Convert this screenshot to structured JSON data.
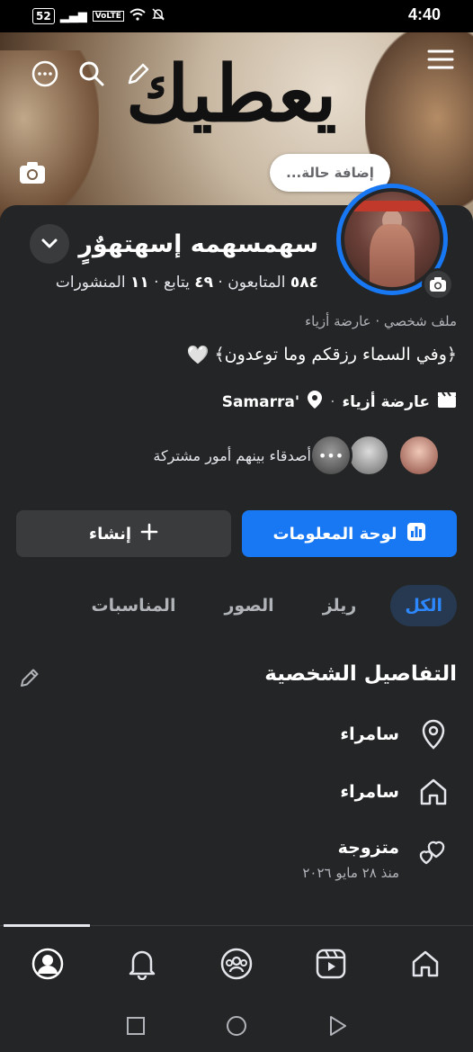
{
  "status_bar": {
    "battery": "52",
    "network": "VoLTE",
    "time": "4:40"
  },
  "cover": {
    "status_placeholder": "إضافة حالة...",
    "calligraphy": "يعطيك"
  },
  "profile": {
    "name": "سهمسهمه إسهتهوٌرٍ",
    "stats": {
      "posts_count": "١١",
      "posts_label": "المنشورات",
      "following_count": "٤٩",
      "following_label": "يتابع",
      "followers_count": "٥٨٤",
      "followers_label": "المتابعون"
    },
    "subtitle": "ملف شخصي · عارضة أزياء",
    "bio": "﴿وفي السماء رزقكم وما توعدون﴾",
    "category": "عارضة أزياء",
    "location": "Samarra'",
    "mutual_friends_text": "أصدقاء بينهم أمور مشتركة"
  },
  "buttons": {
    "dashboard": "لوحة المعلومات",
    "create": "إنشاء"
  },
  "tabs": [
    {
      "label": "الكل",
      "active": true
    },
    {
      "label": "ريلز"
    },
    {
      "label": "الصور"
    },
    {
      "label": "المناسبات"
    }
  ],
  "details": {
    "title": "التفاصيل الشخصية",
    "items": [
      {
        "icon": "location-pin-icon",
        "text": "سامراء"
      },
      {
        "icon": "home-icon",
        "text": "سامراء"
      },
      {
        "icon": "relationship-hearts-icon",
        "text": "متزوجة",
        "sub": "منذ ٢٨ مايو ٢٠٢٦"
      }
    ]
  },
  "colors": {
    "accent": "#1877f2",
    "background": "#242526",
    "button_secondary": "#3a3b3c",
    "tab_active_bg": "#263951"
  }
}
